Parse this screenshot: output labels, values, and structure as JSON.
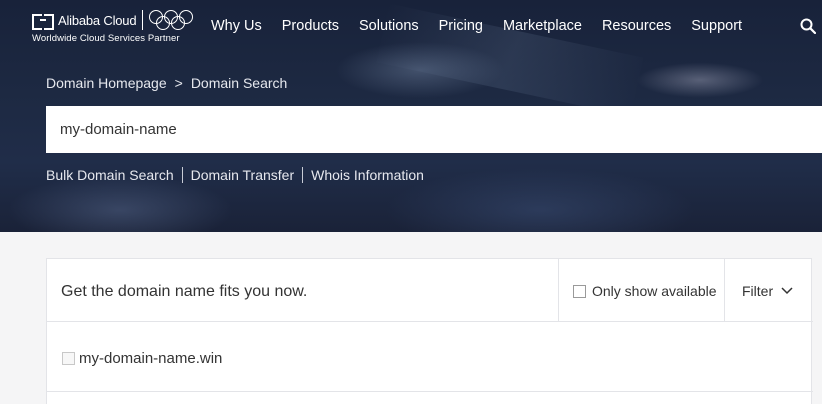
{
  "brand": {
    "name": "Alibaba Cloud",
    "tagline": "Worldwide Cloud Services Partner"
  },
  "nav": {
    "items": [
      "Why Us",
      "Products",
      "Solutions",
      "Pricing",
      "Marketplace",
      "Resources",
      "Support"
    ]
  },
  "breadcrumb": {
    "home": "Domain Homepage",
    "separator": ">",
    "current": "Domain Search"
  },
  "search": {
    "value": "my-domain-name"
  },
  "sublinks": {
    "bulk": "Bulk Domain Search",
    "transfer": "Domain Transfer",
    "whois": "Whois Information"
  },
  "results": {
    "title": "Get the domain name fits you now.",
    "only_available_label": "Only show available",
    "filter_label": "Filter",
    "rows": [
      {
        "domain": "my-domain-name.win"
      }
    ]
  },
  "colors": {
    "hero_bg": "#1d2942",
    "panel_border": "#e3e4e8",
    "page_bg": "#f5f5f6"
  },
  "icons": {
    "search": "search-icon",
    "filter": "chevron-down-icon"
  }
}
